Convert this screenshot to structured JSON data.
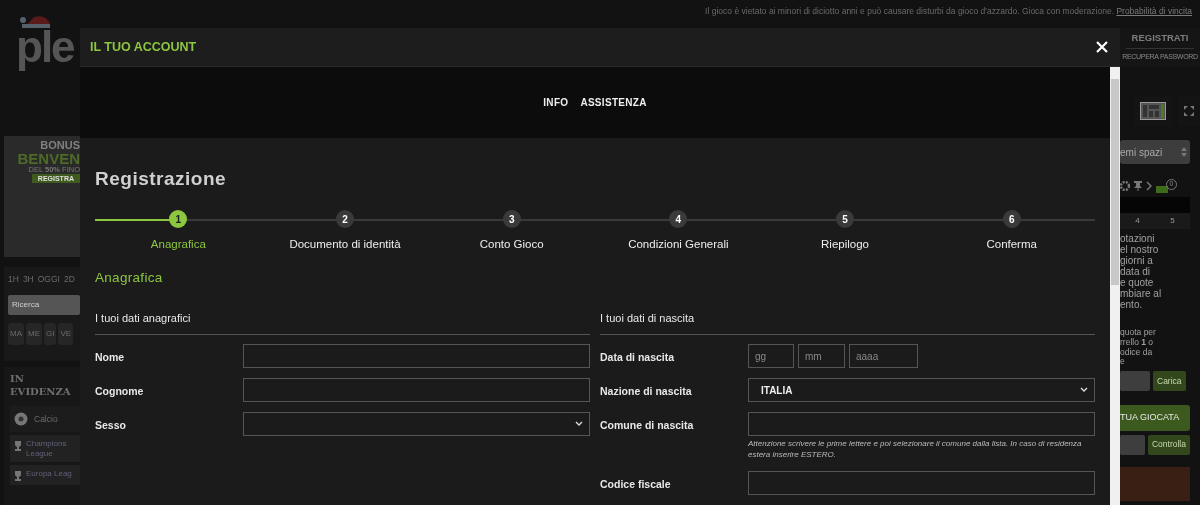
{
  "disclaimer": {
    "text": "Il gioco è vietato ai minori di diciotto anni e può causare disturbi da gioco d'azzardo. Gioca con moderazione.",
    "link": "Probabilità di vincita"
  },
  "logo": {
    "text": "ple"
  },
  "auth": {
    "register": "REGISTRATI",
    "recover": "RECUPERA PASSWORD"
  },
  "left_sidebar": {
    "banner": {
      "lines": [
        "BONUS",
        "BENVEN",
        "DEL **50%** FINO",
        "REGISTRA"
      ]
    },
    "time_filters": [
      "1H",
      "3H",
      "OGGI",
      "2D"
    ],
    "search": {
      "placeholder": "Ricerca"
    },
    "days": [
      "MA",
      "ME",
      "GI",
      "VE"
    ],
    "featured": {
      "title": "IN EVIDENZA",
      "items": [
        {
          "kind": "sport",
          "label": "Calcio"
        },
        {
          "kind": "league",
          "label": "Champions League"
        },
        {
          "kind": "league",
          "label": "Europa Leag"
        }
      ]
    }
  },
  "right_sidebar": {
    "select": "emi spazi",
    "badge": "0",
    "columns": [
      "4",
      "5"
    ],
    "info_lines": [
      "otazioni",
      "el nostro",
      "giorni a",
      "data di",
      "e quote",
      "mbiare al",
      "ento."
    ],
    "code_lines": [
      "quota per",
      "rrello **1** o",
      "odice da",
      "e"
    ],
    "load_button": "Carica",
    "play_button": "TUA GIOCATA",
    "check_button": "Controlla"
  },
  "modal": {
    "title": "IL TUO ACCOUNT",
    "nav": [
      "INFO",
      "ASSISTENZA"
    ],
    "heading": "Registrazione",
    "steps": [
      {
        "number": "1",
        "label": "Anagrafica",
        "selected": true
      },
      {
        "number": "2",
        "label": "Documento di identità",
        "selected": false
      },
      {
        "number": "3",
        "label": "Conto Gioco",
        "selected": false
      },
      {
        "number": "4",
        "label": "Condizioni Generali",
        "selected": false
      },
      {
        "number": "5",
        "label": "Riepilogo",
        "selected": false
      },
      {
        "number": "6",
        "label": "Conferma",
        "selected": false
      }
    ],
    "section": "Anagrafica",
    "left": {
      "title": "I tuoi dati anagrafici",
      "fields": [
        {
          "kind": "input",
          "label": "Nome"
        },
        {
          "kind": "input",
          "label": "Cognome"
        },
        {
          "kind": "select",
          "label": "Sesso"
        }
      ]
    },
    "right": {
      "title": "I tuoi dati di nascita",
      "fields": [
        {
          "kind": "date",
          "label": "Data di nascita",
          "parts": [
            {
              "placeholder": "gg"
            },
            {
              "placeholder": "mm"
            },
            {
              "placeholder": "aaaa"
            }
          ]
        },
        {
          "kind": "select",
          "label": "Nazione di nascita",
          "value": "ITALIA"
        },
        {
          "kind": "input",
          "label": "Comune di nascita",
          "hint": "Attenzione scrivere le prime lettere e poi selezionare il comune dalla lista. In caso di residenza estera inserire ESTERO."
        },
        {
          "kind": "input",
          "label": "Codice fiscale"
        }
      ]
    }
  }
}
